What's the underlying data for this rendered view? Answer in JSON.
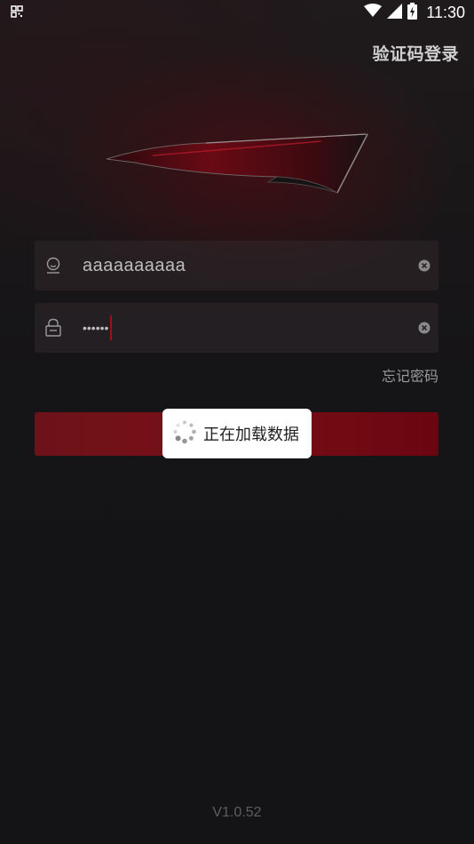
{
  "status_bar": {
    "time": "11:30",
    "icons": [
      "qr-code-icon",
      "wifi-icon",
      "cell-signal-icon",
      "battery-charging-icon"
    ]
  },
  "header": {
    "code_login_label": "验证码登录"
  },
  "logo": {
    "icon": "car-taillight-logo-icon"
  },
  "form": {
    "username": {
      "value": "aaaaaaaaaa",
      "icon": "user-icon",
      "clear_icon": "clear-icon"
    },
    "password": {
      "value": "••••••",
      "icon": "lock-icon",
      "clear_icon": "clear-icon"
    },
    "forgot_password_label": "忘记密码"
  },
  "loading_toast": {
    "text": "正在加载数据",
    "icon": "spinner-icon"
  },
  "footer": {
    "version": "V1.0.52"
  },
  "colors": {
    "accent": "#7a0f17",
    "background": "#141315",
    "caret": "#a10d1a"
  }
}
